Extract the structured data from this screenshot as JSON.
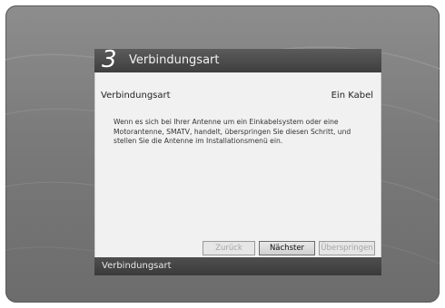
{
  "dialog": {
    "step_number": "3",
    "title": "Verbindungsart",
    "setting": {
      "label": "Verbindungsart",
      "value": "Ein Kabel"
    },
    "info_text": "Wenn es sich bei Ihrer Antenne um ein Einkabelsystem oder eine Motorantenne, SMATV, handelt, überspringen Sie diesen Schritt, und stellen Sie die Antenne im Installationsmenü ein.",
    "buttons": {
      "back": "Zurück",
      "next": "Nächster",
      "skip": "Überspringen"
    },
    "footer": "Verbindungsart"
  }
}
